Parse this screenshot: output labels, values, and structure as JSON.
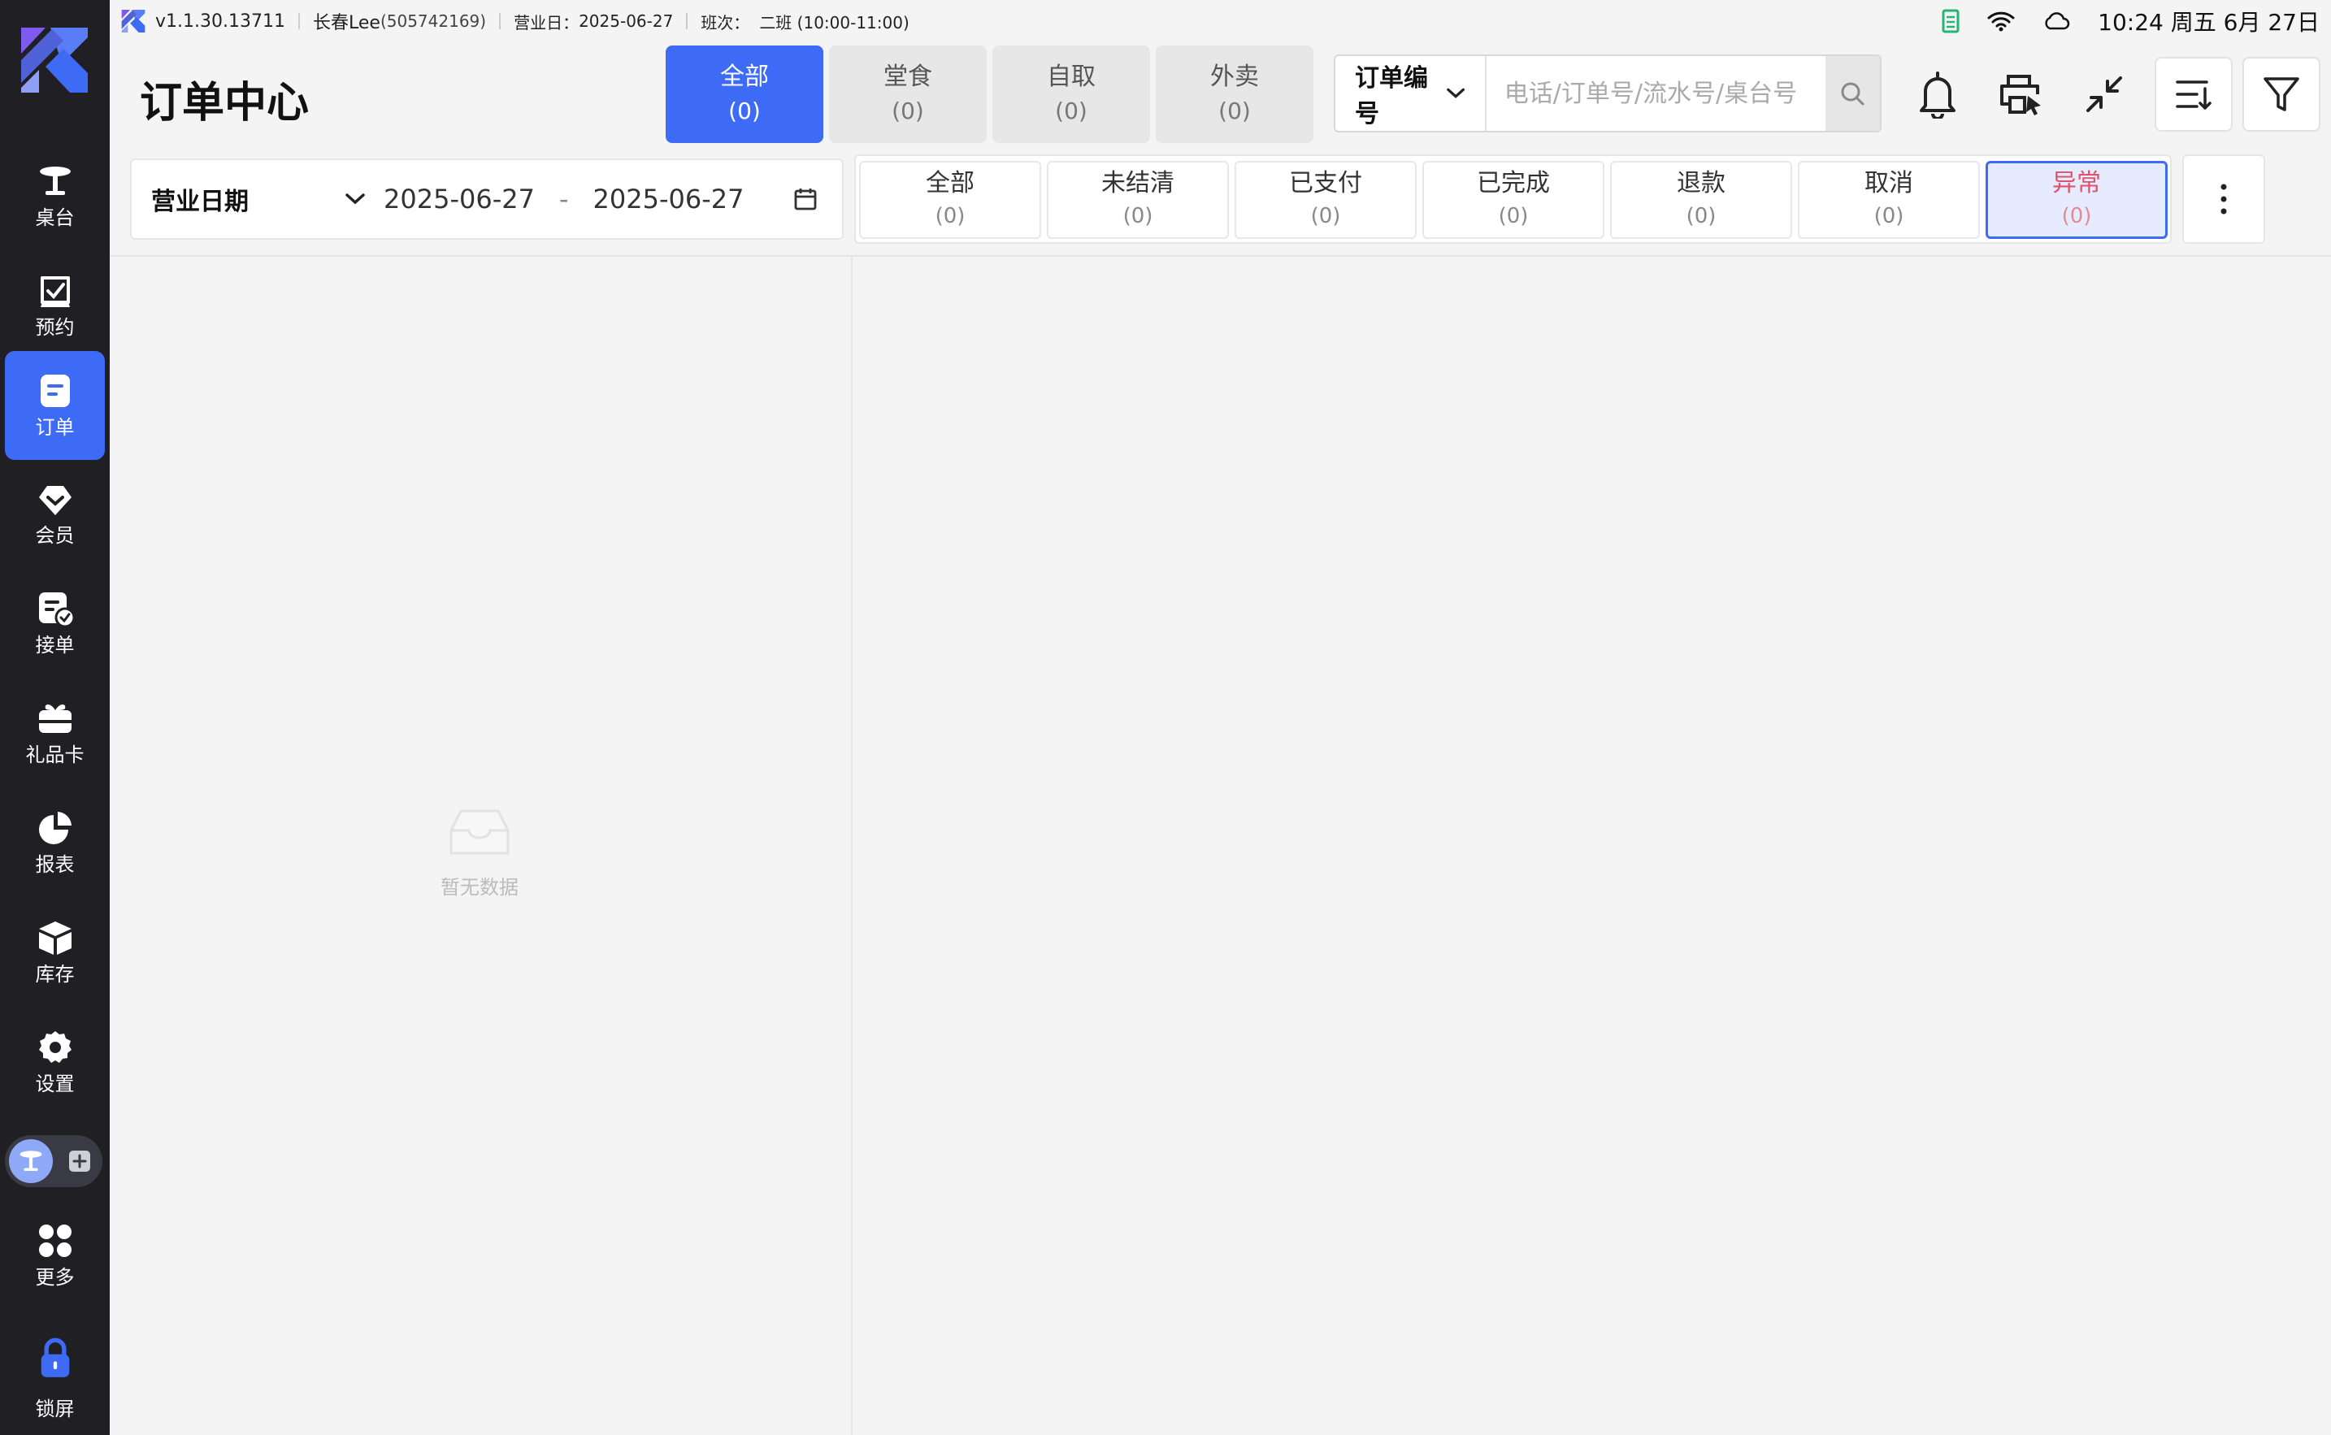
{
  "statusbar": {
    "version": "v1.1.30.13711",
    "user": "长春Lee",
    "user_id": "(505742169)",
    "business_day_label": "营业日：",
    "business_day": "2025-06-27",
    "shift_label": "班次：",
    "shift": "二班 (10:00-11:00)",
    "clock": "10:24 周五 6月 27日"
  },
  "sidebar": {
    "items": [
      {
        "label": "桌台",
        "icon": "table-icon"
      },
      {
        "label": "预约",
        "icon": "reservation-icon"
      },
      {
        "label": "订单",
        "icon": "order-icon"
      },
      {
        "label": "会员",
        "icon": "member-icon"
      },
      {
        "label": "接单",
        "icon": "accept-order-icon"
      },
      {
        "label": "礼品卡",
        "icon": "gift-card-icon"
      },
      {
        "label": "报表",
        "icon": "report-icon"
      },
      {
        "label": "库存",
        "icon": "inventory-icon"
      },
      {
        "label": "设置",
        "icon": "settings-icon"
      },
      {
        "label": "更多",
        "icon": "more-apps-icon"
      },
      {
        "label": "锁屏",
        "icon": "lock-icon"
      }
    ],
    "active": "订单"
  },
  "header": {
    "title": "订单中心",
    "type_tabs": [
      {
        "label": "全部",
        "count": "(0)"
      },
      {
        "label": "堂食",
        "count": "(0)"
      },
      {
        "label": "自取",
        "count": "(0)"
      },
      {
        "label": "外卖",
        "count": "(0)"
      }
    ],
    "search": {
      "type": "订单编号",
      "placeholder": "电话/订单号/流水号/桌台号"
    }
  },
  "filters": {
    "date_type": "营业日期",
    "date_from": "2025-06-27",
    "date_sep": "-",
    "date_to": "2025-06-27",
    "status_tabs": [
      {
        "label": "全部",
        "count": "(0)"
      },
      {
        "label": "未结清",
        "count": "(0)"
      },
      {
        "label": "已支付",
        "count": "(0)"
      },
      {
        "label": "已完成",
        "count": "(0)"
      },
      {
        "label": "退款",
        "count": "(0)"
      },
      {
        "label": "取消",
        "count": "(0)"
      },
      {
        "label": "异常",
        "count": "(0)"
      }
    ],
    "active_status": "异常"
  },
  "empty": {
    "text": "暂无数据"
  },
  "colors": {
    "accent": "#3d6bf5",
    "sidebar_bg": "#202024",
    "alert_text": "#e0526a"
  }
}
